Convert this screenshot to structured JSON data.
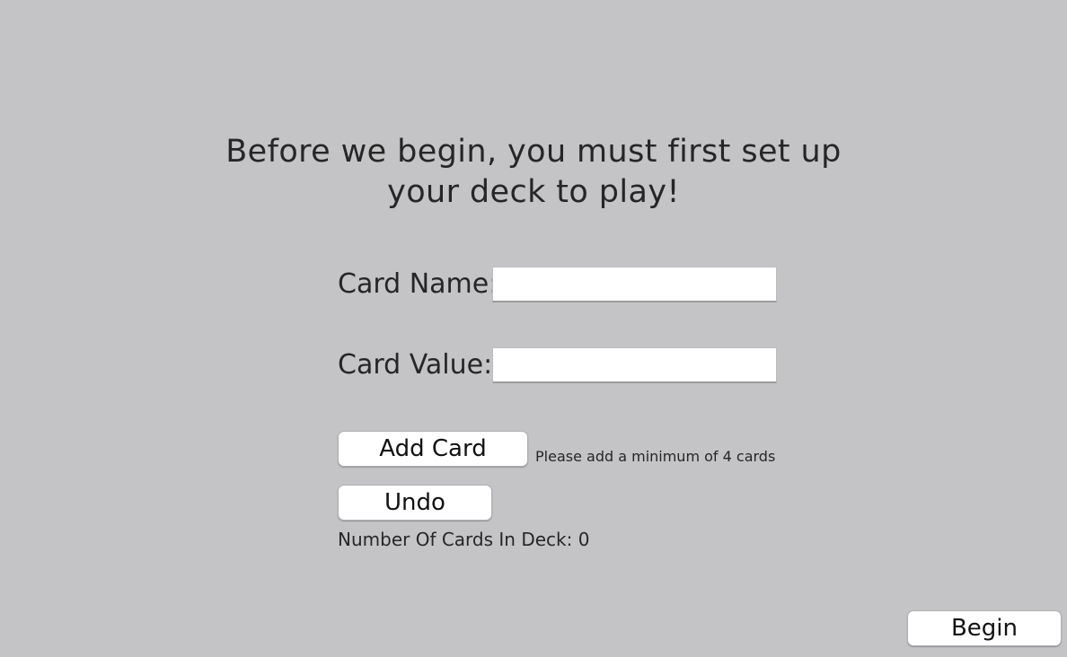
{
  "heading": {
    "line1": "Before we begin, you must first set up",
    "line2": "your deck to play!"
  },
  "form": {
    "card_name_label": "Card Name:",
    "card_name_value": "",
    "card_value_label": "Card Value:",
    "card_value_value": ""
  },
  "actions": {
    "add_card_label": "Add Card",
    "undo_label": "Undo",
    "begin_label": "Begin"
  },
  "hint": "Please add a minimum of 4 cards",
  "deck_count": "Number Of Cards In Deck: 0"
}
